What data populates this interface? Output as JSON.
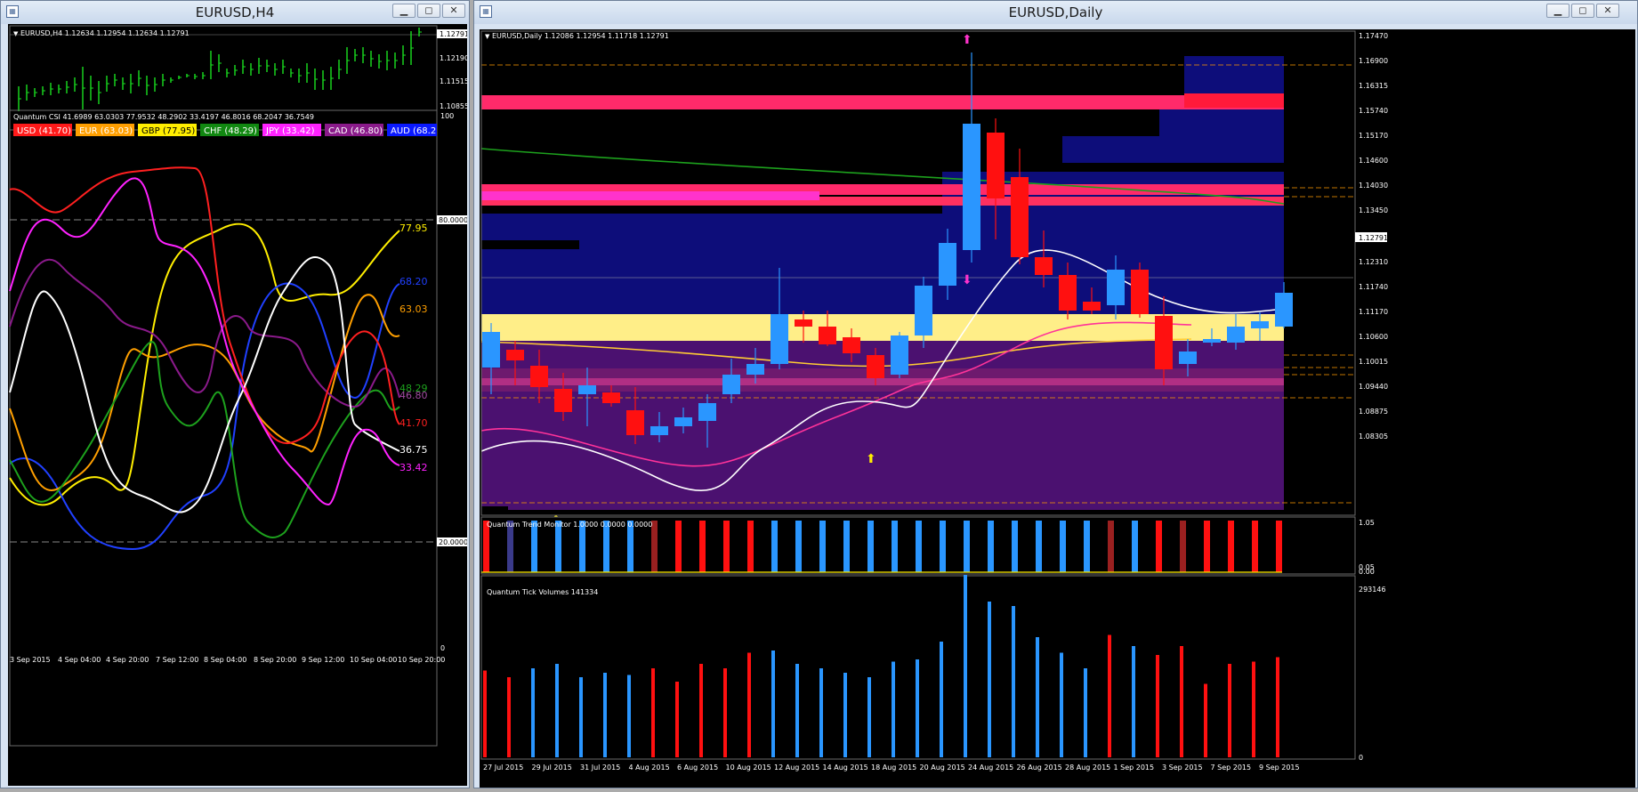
{
  "windows": {
    "left": {
      "title": "EURUSD,H4",
      "info": "EURUSD,H4  1.12634 1.12954 1.12634 1.12791",
      "price_labels": [
        "1.12791",
        "1.12190",
        "1.11515",
        "1.10855"
      ],
      "csi": {
        "title": "Quantum CSI 41.6989 63.0303 77.9532 48.2902 33.4197 46.8016 68.2047 36.7549",
        "badges": [
          {
            "label": "USD (41.70)",
            "color": "#ff1a1a",
            "text": "#ffffff"
          },
          {
            "label": "EUR (63.03)",
            "color": "#ff9f00",
            "text": "#ffffff"
          },
          {
            "label": "GBP (77.95)",
            "color": "#ffee00",
            "text": "#000000"
          },
          {
            "label": "CHF (48.29)",
            "color": "#118811",
            "text": "#ffffff"
          },
          {
            "label": "JPY (33.42)",
            "color": "#ff22ff",
            "text": "#ffffff"
          },
          {
            "label": "CAD (46.80)",
            "color": "#8a1a8a",
            "text": "#ffffff"
          },
          {
            "label": "AUD (68.2",
            "color": "#0a19ff",
            "text": "#ffffff"
          }
        ],
        "scale_labels": [
          "100",
          "80.0000",
          "20.0000",
          "0"
        ],
        "end_values": [
          {
            "label": "77.95",
            "color": "#ffee00"
          },
          {
            "label": "68.20",
            "color": "#2040ff"
          },
          {
            "label": "63.03",
            "color": "#ff9f00"
          },
          {
            "label": "48.29",
            "color": "#1da11d"
          },
          {
            "label": "46.80",
            "color": "#a04aa0"
          },
          {
            "label": "41.70",
            "color": "#ff2020"
          },
          {
            "label": "36.75",
            "color": "#ffffff"
          },
          {
            "label": "33.42",
            "color": "#ff22ff"
          }
        ]
      },
      "time_labels": [
        "3 Sep 2015",
        "4 Sep 04:00",
        "4 Sep 20:00",
        "7 Sep 12:00",
        "8 Sep 04:00",
        "8 Sep 20:00",
        "9 Sep 12:00",
        "10 Sep 04:00",
        "10 Sep 20:00"
      ]
    },
    "right": {
      "title": "EURUSD,Daily",
      "info": "EURUSD,Daily  1.12086 1.12954 1.11718 1.12791",
      "price_labels": [
        "1.17470",
        "1.16900",
        "1.16315",
        "1.15740",
        "1.15170",
        "1.14600",
        "1.14030",
        "1.13450",
        "1.12791",
        "1.12310",
        "1.11740",
        "1.11170",
        "1.10600",
        "1.10015",
        "1.09440",
        "1.08875",
        "1.08305"
      ],
      "trend_monitor": {
        "title": "Quantum Trend Monitor 1.0000 0.0000 0.0000",
        "scale_labels": [
          "1.05",
          "0.05",
          "0.00"
        ]
      },
      "tick_volumes": {
        "title": "Quantum Tick Volumes 141334",
        "scale_labels": [
          "293146",
          "0"
        ]
      },
      "time_labels": [
        "27 Jul 2015",
        "29 Jul 2015",
        "31 Jul 2015",
        "4 Aug 2015",
        "6 Aug 2015",
        "10 Aug 2015",
        "12 Aug 2015",
        "14 Aug 2015",
        "18 Aug 2015",
        "20 Aug 2015",
        "24 Aug 2015",
        "26 Aug 2015",
        "28 Aug 2015",
        "1 Sep 2015",
        "3 Sep 2015",
        "7 Sep 2015",
        "9 Sep 2015"
      ]
    }
  },
  "icons": {
    "app": "chart-window-icon",
    "minimize": "minimize-icon",
    "maximize": "maximize-icon",
    "close": "close-icon"
  }
}
